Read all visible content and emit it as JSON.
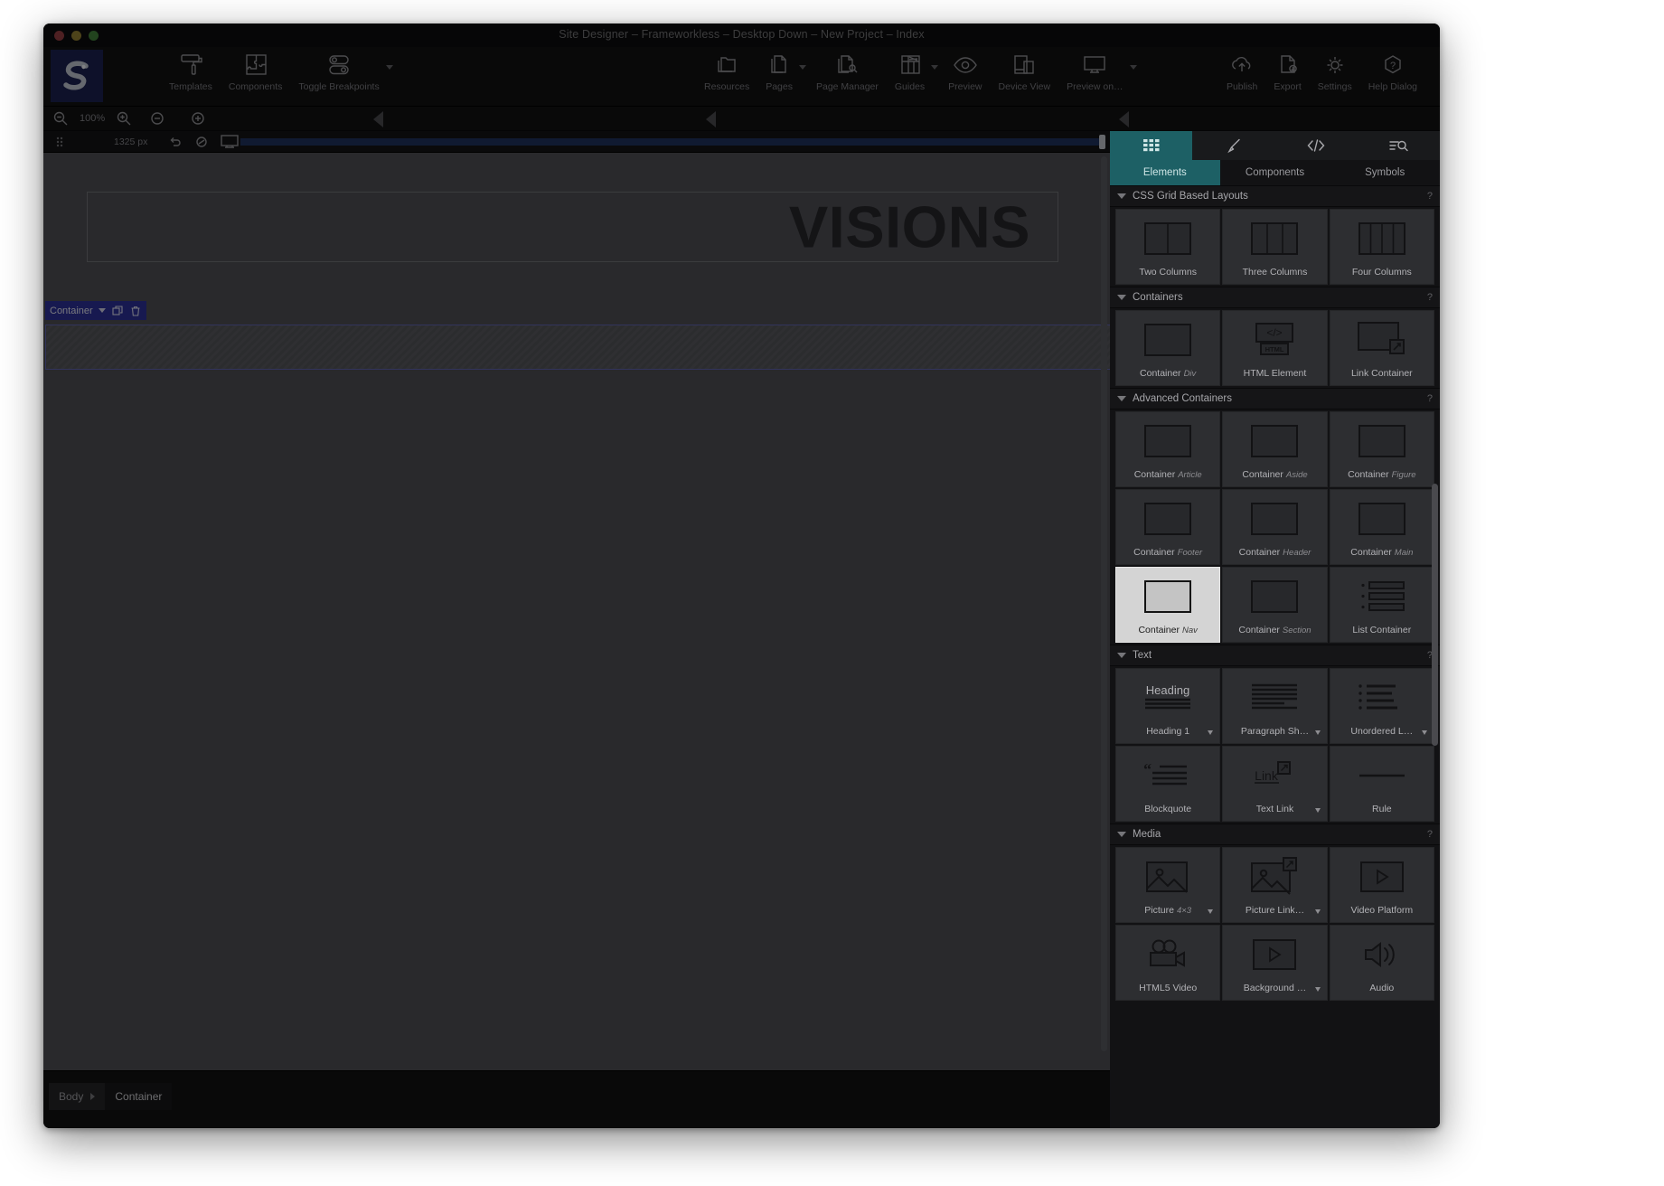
{
  "window": {
    "title": "Site Designer – Frameworkless – Desktop Down – New Project – Index",
    "traffic": {
      "close": "close-button",
      "minimize": "minimize-button",
      "zoom": "zoom-button"
    }
  },
  "toolbar": {
    "left_items": [
      {
        "label": "Templates",
        "icon": "templates-icon",
        "caret": false
      },
      {
        "label": "Components",
        "icon": "components-icon",
        "caret": false
      },
      {
        "label": "Toggle Breakpoints",
        "icon": "toggle-breakpoints-icon",
        "caret": true
      }
    ],
    "center_items": [
      {
        "label": "Resources",
        "icon": "resources-icon",
        "caret": false
      },
      {
        "label": "Pages",
        "icon": "pages-icon",
        "caret": true
      },
      {
        "label": "Page Manager",
        "icon": "page-manager-icon",
        "caret": false
      },
      {
        "label": "Guides",
        "icon": "guides-icon",
        "caret": true
      },
      {
        "label": "Preview",
        "icon": "eye-icon",
        "caret": false
      },
      {
        "label": "Device View",
        "icon": "device-view-icon",
        "caret": false
      },
      {
        "label": "Preview on…",
        "icon": "monitor-icon",
        "caret": true
      }
    ],
    "right_items": [
      {
        "label": "Publish",
        "icon": "publish-cloud-icon",
        "caret": false
      },
      {
        "label": "Export",
        "icon": "export-icon",
        "caret": false
      },
      {
        "label": "Settings",
        "icon": "gear-icon",
        "caret": false
      },
      {
        "label": "Help Dialog",
        "icon": "help-hexagon-icon",
        "caret": false
      }
    ]
  },
  "zoomstrip": {
    "zoom_out_icon": "magnifier-minus-icon",
    "zoom_level": "100%",
    "zoom_in_icon": "magnifier-plus-icon",
    "minus_icon": "minus-circle-icon",
    "plus_icon": "plus-circle-icon",
    "collapse_left_icon": "collapse-left-arrow-icon",
    "collapse_right_icon": "collapse-right-arrow-icon",
    "panel_collapse_icon": "panel-collapse-arrow-icon"
  },
  "breakpointbar": {
    "handle_icon": "breakpoint-grip-icon",
    "width_value": "1325 px",
    "undo_icon": "undo-icon",
    "media_icon": "media-query-icon",
    "desktop_icon": "desktop-icon"
  },
  "canvas": {
    "hero_heading": "VISIONS",
    "selection_badge": {
      "label": "Container",
      "caret_icon": "chevron-down-icon",
      "duplicate_icon": "duplicate-icon",
      "delete_icon": "trash-icon"
    }
  },
  "statusbar": {
    "breadcrumbs": [
      {
        "label": "Body",
        "active": false
      },
      {
        "label": "Container",
        "active": true
      }
    ]
  },
  "right_panel": {
    "tab_icons": [
      {
        "name": "elements-grid-icon",
        "active": true
      },
      {
        "name": "brush-icon",
        "active": false
      },
      {
        "name": "code-icon",
        "active": false
      },
      {
        "name": "search-list-icon",
        "active": false
      }
    ],
    "tabs": [
      {
        "label": "Elements",
        "active": true
      },
      {
        "label": "Components",
        "active": false
      },
      {
        "label": "Symbols",
        "active": false
      }
    ],
    "help_glyph": "?",
    "sections": [
      {
        "title": "CSS Grid Based Layouts",
        "items": [
          {
            "label": "Two Columns",
            "sub": "",
            "art": "two-columns",
            "caret": false,
            "selected": false
          },
          {
            "label": "Three Columns",
            "sub": "",
            "art": "three-columns",
            "caret": false,
            "selected": false
          },
          {
            "label": "Four Columns",
            "sub": "",
            "art": "four-columns",
            "caret": false,
            "selected": false
          }
        ]
      },
      {
        "title": "Containers",
        "items": [
          {
            "label": "Container",
            "sub": "Div",
            "art": "box",
            "caret": false,
            "selected": false
          },
          {
            "label": "HTML Element",
            "sub": "",
            "art": "html-element",
            "caret": false,
            "selected": false
          },
          {
            "label": "Link Container",
            "sub": "",
            "art": "link-box",
            "caret": false,
            "selected": false
          }
        ]
      },
      {
        "title": "Advanced Containers",
        "items": [
          {
            "label": "Container",
            "sub": "Article",
            "art": "box",
            "caret": false,
            "selected": false
          },
          {
            "label": "Container",
            "sub": "Aside",
            "art": "box",
            "caret": false,
            "selected": false
          },
          {
            "label": "Container",
            "sub": "Figure",
            "art": "box",
            "caret": false,
            "selected": false
          },
          {
            "label": "Container",
            "sub": "Footer",
            "art": "box",
            "caret": false,
            "selected": false
          },
          {
            "label": "Container",
            "sub": "Header",
            "art": "box",
            "caret": false,
            "selected": false
          },
          {
            "label": "Container",
            "sub": "Main",
            "art": "box",
            "caret": false,
            "selected": false
          },
          {
            "label": "Container",
            "sub": "Nav",
            "art": "box",
            "caret": false,
            "selected": true
          },
          {
            "label": "Container",
            "sub": "Section",
            "art": "box",
            "caret": false,
            "selected": false
          },
          {
            "label": "List Container",
            "sub": "",
            "art": "list",
            "caret": false,
            "selected": false
          }
        ]
      },
      {
        "title": "Text",
        "items": [
          {
            "label": "Heading 1",
            "sub": "",
            "art": "heading",
            "caret": true,
            "selected": false
          },
          {
            "label": "Paragraph Sh…",
            "sub": "",
            "art": "paragraph",
            "caret": true,
            "selected": false
          },
          {
            "label": "Unordered L…",
            "sub": "",
            "art": "unordered-list",
            "caret": true,
            "selected": false
          },
          {
            "label": "Blockquote",
            "sub": "",
            "art": "blockquote",
            "caret": false,
            "selected": false
          },
          {
            "label": "Text Link",
            "sub": "",
            "art": "text-link",
            "caret": true,
            "selected": false
          },
          {
            "label": "Rule",
            "sub": "",
            "art": "rule",
            "caret": false,
            "selected": false
          }
        ]
      },
      {
        "title": "Media",
        "items": [
          {
            "label": "Picture",
            "sub": "4×3",
            "art": "picture",
            "caret": true,
            "selected": false
          },
          {
            "label": "Picture Link…",
            "sub": "",
            "art": "picture-link",
            "caret": true,
            "selected": false
          },
          {
            "label": "Video Platform",
            "sub": "",
            "art": "video-frame",
            "caret": false,
            "selected": false
          },
          {
            "label": "HTML5 Video",
            "sub": "",
            "art": "camcorder",
            "caret": false,
            "selected": false
          },
          {
            "label": "Background …",
            "sub": "",
            "art": "video-frame",
            "caret": true,
            "selected": false
          },
          {
            "label": "Audio",
            "sub": "",
            "art": "speaker",
            "caret": false,
            "selected": false
          }
        ]
      }
    ]
  },
  "colors": {
    "accent_teal": "#1d6065",
    "selection_blue": "#2b2f92",
    "canvas_bg": "#4b4c51",
    "panel_bg": "#121214",
    "chrome_bg": "#111112"
  }
}
